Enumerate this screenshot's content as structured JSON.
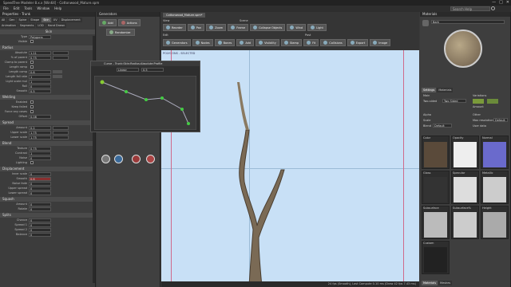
{
  "app": {
    "title": "SpeedTree Modeler 8.x.x [Win64] - Cottonwood_Mature.spm",
    "min": "—",
    "max": "□",
    "close": "✕"
  },
  "menu": [
    "File",
    "Edit",
    "Tools",
    "Window",
    "Help"
  ],
  "search_label": "Search Help",
  "properties": {
    "title": "Properties - Trunk",
    "tabs": [
      "All",
      "Gen",
      "Spine",
      "Shape",
      "Skin",
      "UV",
      "Displacement",
      "Material"
    ],
    "tabs2": [
      "Animation",
      "Segments",
      "LOD",
      "Hand Drawn"
    ],
    "sub_label": "Skin",
    "rows": [
      {
        "label": "Type",
        "value": "Polygons",
        "kind": "val"
      },
      {
        "label": "Visible",
        "value": "",
        "kind": "chk"
      }
    ],
    "radius_section": "Radius",
    "radius_rows": [
      {
        "label": "Absolute",
        "value": "1.11",
        "kind": "curve"
      },
      {
        "label": "% of parent",
        "value": "0.75",
        "kind": "curve"
      },
      {
        "label": "Clamp to parent",
        "value": "",
        "kind": "chk"
      },
      {
        "label": "Length ramp",
        "value": "",
        "kind": "chk"
      },
      {
        "label": "Length comp",
        "value": "0.6",
        "kind": "slider"
      },
      {
        "label": "Length fall rate",
        "value": "1",
        "kind": "slider"
      }
    ],
    "light_rows": [
      {
        "label": "Light scale mul",
        "value": "1",
        "kind": "val"
      },
      {
        "label": "Roll",
        "value": "0",
        "kind": "val"
      },
      {
        "label": "Smooth",
        "value": "0.5",
        "kind": "val"
      }
    ],
    "welding_section": "Welding",
    "welding_rows": [
      {
        "label": "Enabled",
        "value": "",
        "kind": "chk"
      },
      {
        "label": "Keep failed",
        "value": "",
        "kind": "chk"
      },
      {
        "label": "Force any cases",
        "value": "",
        "kind": "chk"
      },
      {
        "label": "Offset",
        "value": "0.08",
        "kind": "val"
      }
    ],
    "spread_section": "Spread",
    "spread_rows": [
      {
        "label": "Amount",
        "value": "0.2",
        "kind": "curve"
      },
      {
        "label": "Upper scale",
        "value": "1.75",
        "kind": "curve"
      },
      {
        "label": "Lower scale",
        "value": "1.75",
        "kind": "curve"
      }
    ],
    "blend_section": "Blend",
    "blend_rows": [
      {
        "label": "Texture",
        "value": "0.75",
        "kind": "val"
      },
      {
        "label": "Contrast",
        "value": "1",
        "kind": "val"
      },
      {
        "label": "Noise",
        "value": "0",
        "kind": "val"
      },
      {
        "label": "Lighting",
        "value": "",
        "kind": "chk"
      }
    ],
    "displace_section": "Displacement",
    "displace_rows": [
      {
        "label": "Inner scale",
        "value": "0",
        "kind": "val"
      },
      {
        "label": "Smooth",
        "value": "0.6",
        "kind": "red"
      },
      {
        "label": "Noise fade",
        "value": "0",
        "kind": "val"
      },
      {
        "label": "Upper spread",
        "value": "0",
        "kind": "val"
      },
      {
        "label": "Lower spread",
        "value": "0",
        "kind": "val"
      }
    ],
    "squash_section": "Squash",
    "squash_rows": [
      {
        "label": "Amount",
        "value": "0",
        "kind": "val"
      },
      {
        "label": "Rotate",
        "value": "0",
        "kind": "val"
      }
    ],
    "splits_section": "Splits",
    "splits_rows": [
      {
        "label": "Chance",
        "value": "0",
        "kind": "val"
      },
      {
        "label": "Spread 1",
        "value": "0",
        "kind": "val"
      },
      {
        "label": "Spread 2",
        "value": "0",
        "kind": "val"
      },
      {
        "label": "Balance",
        "value": "0",
        "kind": "val"
      }
    ]
  },
  "generators": {
    "title": "Generators",
    "add_label": "Add",
    "actions_label": "Actions",
    "randomize_label": "Randomize"
  },
  "curve_popup": {
    "title": "Curve - Trunk:Skin:Radius:Absolute:Profile",
    "preset": "Linear",
    "value": "0.5"
  },
  "scene": {
    "tab_label": "Cottonwood_Mature.spm*",
    "view_label": "View",
    "edit_label": "Edit",
    "scene_label": "Scene",
    "post_label": "Post",
    "view_buttons": [
      "Reorder",
      "Pan",
      "Zoom",
      "Frame",
      "Collapse Objects",
      "Wind",
      "Light"
    ],
    "edit_buttons": [
      "Generators",
      "Nodes",
      "Bones",
      "Add",
      "Visibility",
      "Stamp",
      "Fit",
      "Collisions",
      "Export",
      "Image"
    ],
    "viewport_info": "POLYGONS - SELECTED",
    "status": "24 fps (Smooth), Last Compute 0.10 ms (Draw 42 fps 7.43 ms)"
  },
  "materials": {
    "title": "Materials",
    "selected": "Bark",
    "settings_tab": "Settings",
    "maps_tab": "Materials",
    "main_section": "Main",
    "two_sided_label": "Two-sided",
    "two_sided_value": "Two Sided",
    "variations_label": "Variations",
    "amount_label": "Amount",
    "alpha_label": "Alpha",
    "scale_label": "Scale",
    "blend_label": "Blend",
    "blend_value": "Default",
    "other_label": "Other",
    "max_label": "Max resolution",
    "max_value": "Default",
    "user_data_label": "User data",
    "map_labels": [
      "Color",
      "Opacity",
      "Normal",
      "Gloss",
      "Specular",
      "Metallic",
      "Subsurface",
      "Subsurface%",
      "Height",
      "Custom"
    ],
    "bottom_tabs": [
      "Materials",
      "Meshes"
    ]
  },
  "colors": {
    "accent": "#7a9a3a",
    "viewport": "#c8e0f6",
    "tree": "#7a6a55"
  }
}
